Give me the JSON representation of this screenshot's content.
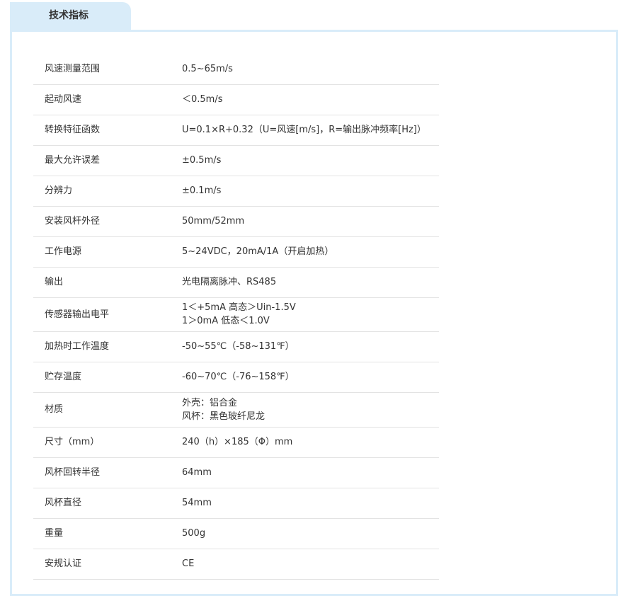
{
  "tab": {
    "title": "技术指标"
  },
  "specs": [
    {
      "label": "风速测量范围",
      "value": [
        "0.5~65m/s"
      ]
    },
    {
      "label": "起动风速",
      "value": [
        "＜0.5m/s"
      ]
    },
    {
      "label": "转换特征函数",
      "value": [
        "U=0.1×R+0.32（U=风速[m/s]，R=输出脉冲频率[Hz]）"
      ]
    },
    {
      "label": "最大允许误差",
      "value": [
        "±0.5m/s"
      ]
    },
    {
      "label": "分辨力",
      "value": [
        "±0.1m/s"
      ]
    },
    {
      "label": "安装风杆外径",
      "value": [
        "50mm/52mm"
      ]
    },
    {
      "label": "工作电源",
      "value": [
        "5~24VDC，20mA/1A（开启加热）"
      ]
    },
    {
      "label": "输出",
      "value": [
        "光电隔离脉冲、RS485"
      ]
    },
    {
      "label": "传感器输出电平",
      "value": [
        "1＜+5mA 高态＞Uin-1.5V",
        "1＞0mA 低态＜1.0V"
      ]
    },
    {
      "label": "加热时工作温度",
      "value": [
        "-50~55℃（-58~131℉）"
      ]
    },
    {
      "label": "贮存温度",
      "value": [
        "-60~70℃（-76~158℉）"
      ]
    },
    {
      "label": "材质",
      "value": [
        "外壳：铝合金",
        "风杯：黑色玻纤尼龙"
      ]
    },
    {
      "label": "尺寸（mm）",
      "value": [
        "240（h）×185（Φ）mm"
      ]
    },
    {
      "label": "风杯回转半径",
      "value": [
        "64mm"
      ]
    },
    {
      "label": "风杯直径",
      "value": [
        "54mm"
      ]
    },
    {
      "label": "重量",
      "value": [
        "500g"
      ]
    },
    {
      "label": "安规认证",
      "value": [
        "CE"
      ]
    }
  ]
}
